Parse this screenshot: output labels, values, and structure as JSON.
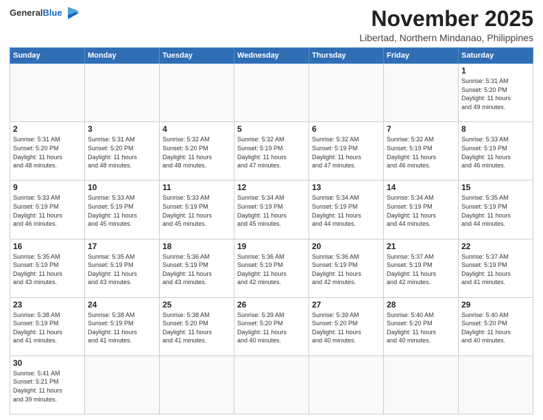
{
  "header": {
    "logo_general": "General",
    "logo_blue": "Blue",
    "month_title": "November 2025",
    "location": "Libertad, Northern Mindanao, Philippines"
  },
  "weekdays": [
    "Sunday",
    "Monday",
    "Tuesday",
    "Wednesday",
    "Thursday",
    "Friday",
    "Saturday"
  ],
  "weeks": [
    [
      {
        "day": "",
        "info": ""
      },
      {
        "day": "",
        "info": ""
      },
      {
        "day": "",
        "info": ""
      },
      {
        "day": "",
        "info": ""
      },
      {
        "day": "",
        "info": ""
      },
      {
        "day": "",
        "info": ""
      },
      {
        "day": "1",
        "info": "Sunrise: 5:31 AM\nSunset: 5:20 PM\nDaylight: 11 hours\nand 49 minutes."
      }
    ],
    [
      {
        "day": "2",
        "info": "Sunrise: 5:31 AM\nSunset: 5:20 PM\nDaylight: 11 hours\nand 48 minutes."
      },
      {
        "day": "3",
        "info": "Sunrise: 5:31 AM\nSunset: 5:20 PM\nDaylight: 11 hours\nand 48 minutes."
      },
      {
        "day": "4",
        "info": "Sunrise: 5:32 AM\nSunset: 5:20 PM\nDaylight: 11 hours\nand 48 minutes."
      },
      {
        "day": "5",
        "info": "Sunrise: 5:32 AM\nSunset: 5:19 PM\nDaylight: 11 hours\nand 47 minutes."
      },
      {
        "day": "6",
        "info": "Sunrise: 5:32 AM\nSunset: 5:19 PM\nDaylight: 11 hours\nand 47 minutes."
      },
      {
        "day": "7",
        "info": "Sunrise: 5:32 AM\nSunset: 5:19 PM\nDaylight: 11 hours\nand 46 minutes."
      },
      {
        "day": "8",
        "info": "Sunrise: 5:33 AM\nSunset: 5:19 PM\nDaylight: 11 hours\nand 46 minutes."
      }
    ],
    [
      {
        "day": "9",
        "info": "Sunrise: 5:33 AM\nSunset: 5:19 PM\nDaylight: 11 hours\nand 46 minutes."
      },
      {
        "day": "10",
        "info": "Sunrise: 5:33 AM\nSunset: 5:19 PM\nDaylight: 11 hours\nand 45 minutes."
      },
      {
        "day": "11",
        "info": "Sunrise: 5:33 AM\nSunset: 5:19 PM\nDaylight: 11 hours\nand 45 minutes."
      },
      {
        "day": "12",
        "info": "Sunrise: 5:34 AM\nSunset: 5:19 PM\nDaylight: 11 hours\nand 45 minutes."
      },
      {
        "day": "13",
        "info": "Sunrise: 5:34 AM\nSunset: 5:19 PM\nDaylight: 11 hours\nand 44 minutes."
      },
      {
        "day": "14",
        "info": "Sunrise: 5:34 AM\nSunset: 5:19 PM\nDaylight: 11 hours\nand 44 minutes."
      },
      {
        "day": "15",
        "info": "Sunrise: 5:35 AM\nSunset: 5:19 PM\nDaylight: 11 hours\nand 44 minutes."
      }
    ],
    [
      {
        "day": "16",
        "info": "Sunrise: 5:35 AM\nSunset: 5:19 PM\nDaylight: 11 hours\nand 43 minutes."
      },
      {
        "day": "17",
        "info": "Sunrise: 5:35 AM\nSunset: 5:19 PM\nDaylight: 11 hours\nand 43 minutes."
      },
      {
        "day": "18",
        "info": "Sunrise: 5:36 AM\nSunset: 5:19 PM\nDaylight: 11 hours\nand 43 minutes."
      },
      {
        "day": "19",
        "info": "Sunrise: 5:36 AM\nSunset: 5:19 PM\nDaylight: 11 hours\nand 42 minutes."
      },
      {
        "day": "20",
        "info": "Sunrise: 5:36 AM\nSunset: 5:19 PM\nDaylight: 11 hours\nand 42 minutes."
      },
      {
        "day": "21",
        "info": "Sunrise: 5:37 AM\nSunset: 5:19 PM\nDaylight: 11 hours\nand 42 minutes."
      },
      {
        "day": "22",
        "info": "Sunrise: 5:37 AM\nSunset: 5:19 PM\nDaylight: 11 hours\nand 41 minutes."
      }
    ],
    [
      {
        "day": "23",
        "info": "Sunrise: 5:38 AM\nSunset: 5:19 PM\nDaylight: 11 hours\nand 41 minutes."
      },
      {
        "day": "24",
        "info": "Sunrise: 5:38 AM\nSunset: 5:19 PM\nDaylight: 11 hours\nand 41 minutes."
      },
      {
        "day": "25",
        "info": "Sunrise: 5:38 AM\nSunset: 5:20 PM\nDaylight: 11 hours\nand 41 minutes."
      },
      {
        "day": "26",
        "info": "Sunrise: 5:39 AM\nSunset: 5:20 PM\nDaylight: 11 hours\nand 40 minutes."
      },
      {
        "day": "27",
        "info": "Sunrise: 5:39 AM\nSunset: 5:20 PM\nDaylight: 11 hours\nand 40 minutes."
      },
      {
        "day": "28",
        "info": "Sunrise: 5:40 AM\nSunset: 5:20 PM\nDaylight: 11 hours\nand 40 minutes."
      },
      {
        "day": "29",
        "info": "Sunrise: 5:40 AM\nSunset: 5:20 PM\nDaylight: 11 hours\nand 40 minutes."
      }
    ],
    [
      {
        "day": "30",
        "info": "Sunrise: 5:41 AM\nSunset: 5:21 PM\nDaylight: 11 hours\nand 39 minutes."
      },
      {
        "day": "",
        "info": ""
      },
      {
        "day": "",
        "info": ""
      },
      {
        "day": "",
        "info": ""
      },
      {
        "day": "",
        "info": ""
      },
      {
        "day": "",
        "info": ""
      },
      {
        "day": "",
        "info": ""
      }
    ]
  ]
}
